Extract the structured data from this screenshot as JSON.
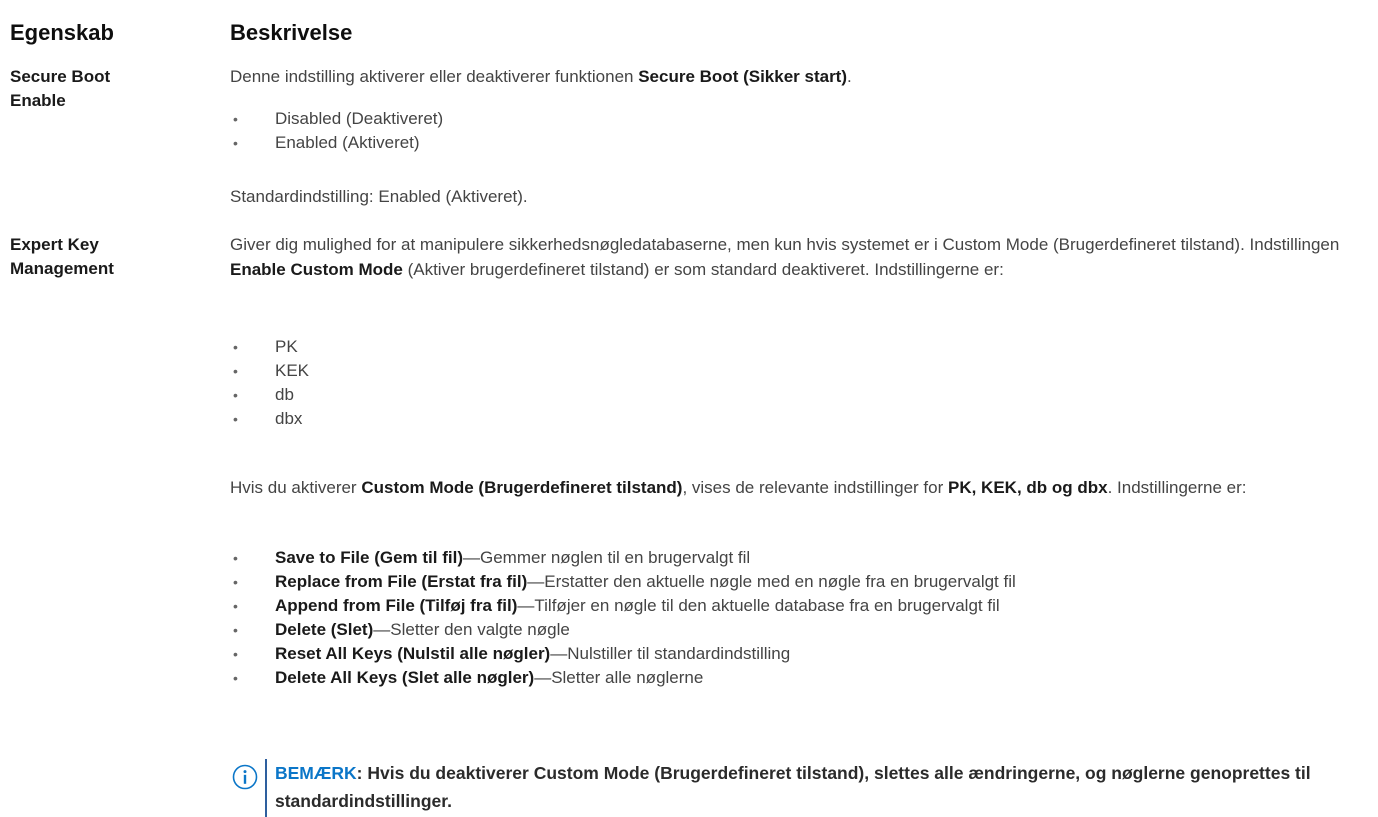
{
  "header": {
    "property": "Egenskab",
    "description": "Beskrivelse"
  },
  "rows": [
    {
      "property_line1": "Secure Boot",
      "property_line2": "Enable",
      "intro_prefix": "Denne indstilling aktiverer eller deaktiverer funktionen ",
      "intro_bold": "Secure Boot (Sikker start)",
      "intro_suffix": ".",
      "options": [
        "Disabled (Deaktiveret)",
        "Enabled (Aktiveret)"
      ],
      "default": "Standardindstilling: Enabled (Aktiveret)."
    },
    {
      "property_line1": "Expert Key",
      "property_line2": "Management",
      "para1_a": "Giver dig mulighed for at manipulere sikkerhedsnøgledatabaserne, men kun hvis systemet er i Custom Mode (Brugerdefineret tilstand). Indstillingen ",
      "para1_bold": "Enable Custom Mode",
      "para1_b": " (Aktiver brugerdefineret tilstand) er som standard deaktiveret. Indstillingerne er:",
      "keys": [
        "PK",
        "KEK",
        "db",
        "dbx"
      ],
      "para2_a": "Hvis du aktiverer ",
      "para2_bold1": "Custom Mode (Brugerdefineret tilstand)",
      "para2_b": ", vises de relevante indstillinger for ",
      "para2_bold2": "PK, KEK, db og dbx",
      "para2_c": ". Indstillingerne er:",
      "actions": [
        {
          "name": "Save to File (Gem til fil)",
          "desc": "—Gemmer nøglen til en brugervalgt fil"
        },
        {
          "name": "Replace from File (Erstat fra fil)",
          "desc": "—Erstatter den aktuelle nøgle med en nøgle fra en brugervalgt fil"
        },
        {
          "name": "Append from File (Tilføj fra fil)",
          "desc": "—Tilføjer en nøgle til den aktuelle database fra en brugervalgt fil"
        },
        {
          "name": "Delete (Slet)",
          "desc": "—Sletter den valgte nøgle"
        },
        {
          "name": "Reset All Keys (Nulstil alle nøgler)",
          "desc": "—Nulstiller til standardindstilling"
        },
        {
          "name": "Delete All Keys (Slet alle nøgler)",
          "desc": "—Sletter alle nøglerne"
        }
      ]
    }
  ],
  "note": {
    "lead": "BEMÆRK",
    "text": ": Hvis du deaktiverer Custom Mode (Brugerdefineret tilstand), slettes alle ændringerne, og nøglerne genoprettes til standardindstillinger.",
    "icon": "info-icon",
    "accent_color": "#0b76c8"
  },
  "bullet_glyph": "•"
}
